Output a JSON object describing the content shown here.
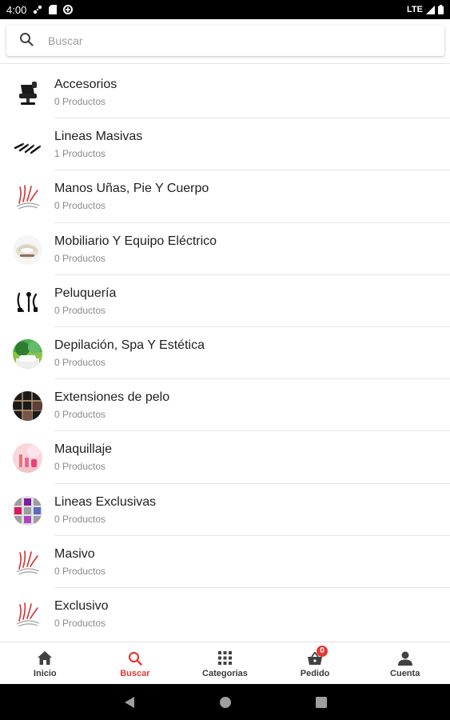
{
  "status_bar": {
    "time": "4:00",
    "network": "LTE"
  },
  "search": {
    "placeholder": "Buscar",
    "value": ""
  },
  "categories": [
    {
      "name": "Accesorios",
      "count": "0 Productos",
      "thumb": "chair"
    },
    {
      "name": "Lineas Masivas",
      "count": "1 Productos",
      "thumb": "brushes"
    },
    {
      "name": "Manos Uñas, Pie Y Cuerpo",
      "count": "0 Productos",
      "thumb": "logo"
    },
    {
      "name": "Mobiliario Y Equipo Eléctrico",
      "count": "0 Productos",
      "thumb": "lamp"
    },
    {
      "name": "Peluquería",
      "count": "0 Productos",
      "thumb": "tools"
    },
    {
      "name": "Depilación, Spa Y Estética",
      "count": "0 Productos",
      "thumb": "spa"
    },
    {
      "name": "Extensiones de pelo",
      "count": "0 Productos",
      "thumb": "hair"
    },
    {
      "name": "Maquillaje",
      "count": "0 Productos",
      "thumb": "makeup"
    },
    {
      "name": "Lineas Exclusivas",
      "count": "0 Productos",
      "thumb": "exclusive"
    },
    {
      "name": "Masivo",
      "count": "0 Productos",
      "thumb": "logo"
    },
    {
      "name": "Exclusivo",
      "count": "0 Productos",
      "thumb": "logo"
    }
  ],
  "bottom_nav": [
    {
      "label": "Inicio",
      "icon": "home-icon",
      "active": false
    },
    {
      "label": "Buscar",
      "icon": "search-icon",
      "active": true
    },
    {
      "label": "Categorias",
      "icon": "grid-icon",
      "active": false
    },
    {
      "label": "Pedido",
      "icon": "basket-icon",
      "active": false,
      "badge": "0"
    },
    {
      "label": "Cuenta",
      "icon": "person-icon",
      "active": false
    }
  ],
  "colors": {
    "accent": "#e53935",
    "text": "#212121",
    "muted": "#8a8a8a"
  }
}
